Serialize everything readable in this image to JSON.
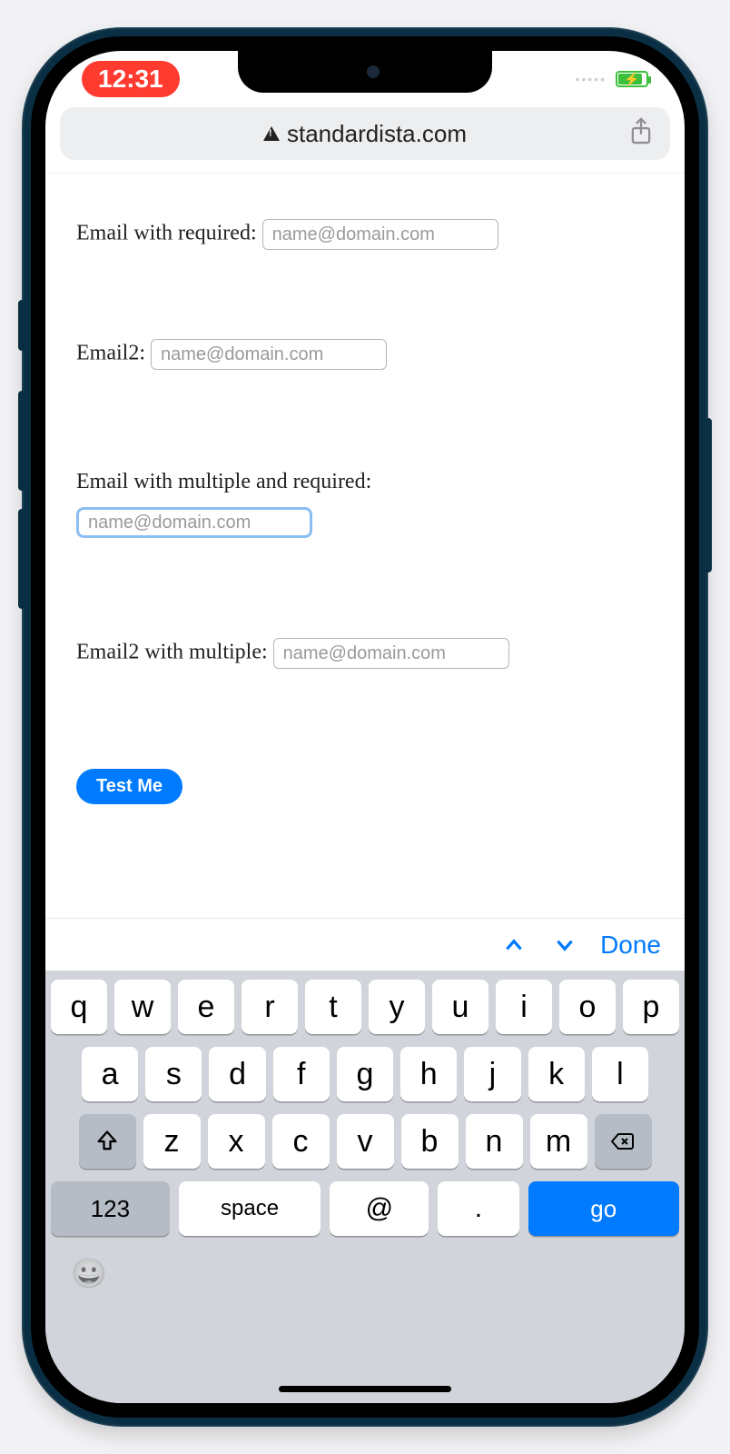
{
  "status": {
    "time": "12:31"
  },
  "browser": {
    "domain": "standardista.com"
  },
  "form": {
    "fields": [
      {
        "label": "Email with required:",
        "placeholder": "name@domain.com",
        "inline": true,
        "focused": false
      },
      {
        "label": "Email2:",
        "placeholder": "name@domain.com",
        "inline": true,
        "focused": false
      },
      {
        "label": "Email with multiple and required:",
        "placeholder": "name@domain.com",
        "inline": false,
        "focused": true
      },
      {
        "label": "Email2 with multiple:",
        "placeholder": "name@domain.com",
        "inline": true,
        "focused": false
      }
    ],
    "submit_label": "Test Me"
  },
  "kbacc": {
    "done": "Done"
  },
  "keyboard": {
    "row1": [
      "q",
      "w",
      "e",
      "r",
      "t",
      "y",
      "u",
      "i",
      "o",
      "p"
    ],
    "row2": [
      "a",
      "s",
      "d",
      "f",
      "g",
      "h",
      "j",
      "k",
      "l"
    ],
    "row3": [
      "z",
      "x",
      "c",
      "v",
      "b",
      "n",
      "m"
    ],
    "numkey": "123",
    "space": "space",
    "at": "@",
    "dot": ".",
    "go": "go"
  }
}
